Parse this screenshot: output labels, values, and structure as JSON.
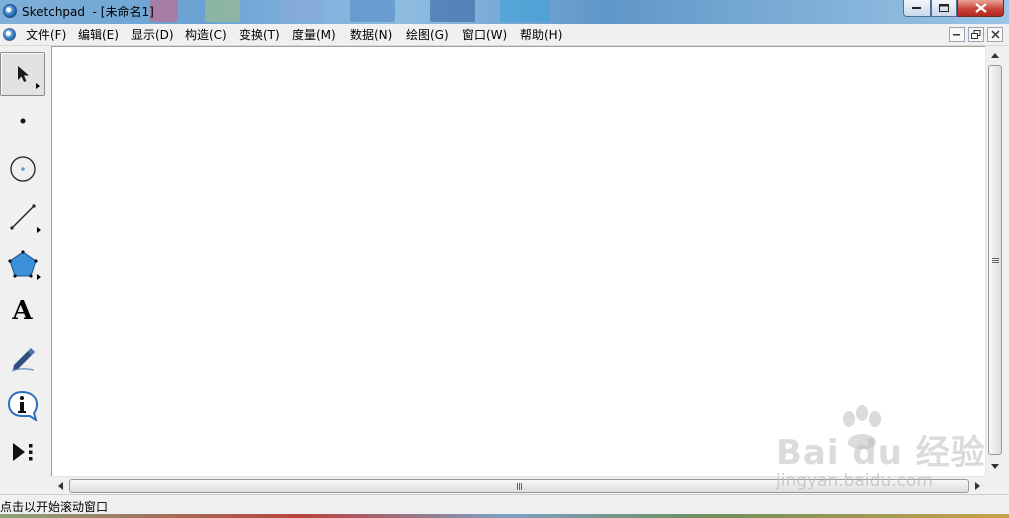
{
  "window": {
    "title": "Sketchpad  - [未命名1]",
    "buttons": {
      "minimize": "minimize",
      "maximize": "maximize",
      "close": "close"
    }
  },
  "menu": {
    "items": [
      {
        "label": "文件(F)"
      },
      {
        "label": "编辑(E)"
      },
      {
        "label": "显示(D)"
      },
      {
        "label": "构造(C)"
      },
      {
        "label": "变换(T)"
      },
      {
        "label": "度量(M)"
      },
      {
        "label": "数据(N)"
      },
      {
        "label": "绘图(G)"
      },
      {
        "label": "窗口(W)"
      },
      {
        "label": "帮助(H)"
      }
    ]
  },
  "toolbox": {
    "tools": [
      {
        "name": "arrow-selection-tool",
        "icon": "arrow-icon",
        "active": true
      },
      {
        "name": "point-tool",
        "icon": "point-icon",
        "active": false
      },
      {
        "name": "compass-tool",
        "icon": "circle-icon",
        "active": false
      },
      {
        "name": "straightedge-tool",
        "icon": "segment-icon",
        "active": false
      },
      {
        "name": "polygon-tool",
        "icon": "polygon-icon",
        "active": false
      },
      {
        "name": "text-tool",
        "icon": "text-icon",
        "glyph": "A",
        "active": false
      },
      {
        "name": "marker-tool",
        "icon": "pen-icon",
        "active": false
      },
      {
        "name": "information-tool",
        "icon": "info-icon",
        "glyph": "i",
        "active": false
      },
      {
        "name": "custom-tool",
        "icon": "play-dots-icon",
        "active": false
      }
    ]
  },
  "status": {
    "text": "点击以开始滚动窗口"
  },
  "watermark": {
    "main": "Bai  du 经验",
    "sub": "jingyan.baidu.com"
  },
  "colors": {
    "polygon_fill": "#3c8fd9",
    "close_button": "#c8453a",
    "watermark": "#bebebe"
  }
}
